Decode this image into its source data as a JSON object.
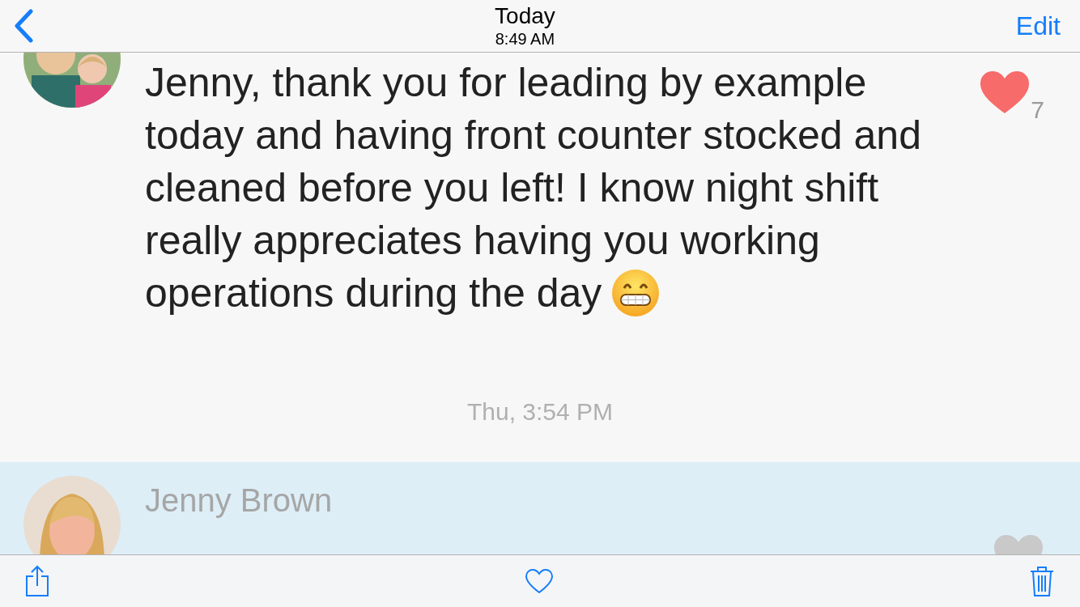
{
  "nav": {
    "title": "Today",
    "subtitle": "8:49 AM",
    "action": "Edit"
  },
  "messages": [
    {
      "text": "Jenny, thank you for leading by example today and having front counter stocked and cleaned before you left! I know night shift really appreciates having you working operations during the day",
      "emoji": true,
      "liked": true,
      "like_count": "7",
      "selected": false,
      "timestamp": "Thu, 3:54 PM"
    },
    {
      "sender": "Jenny Brown",
      "liked": false,
      "selected": true
    }
  ]
}
